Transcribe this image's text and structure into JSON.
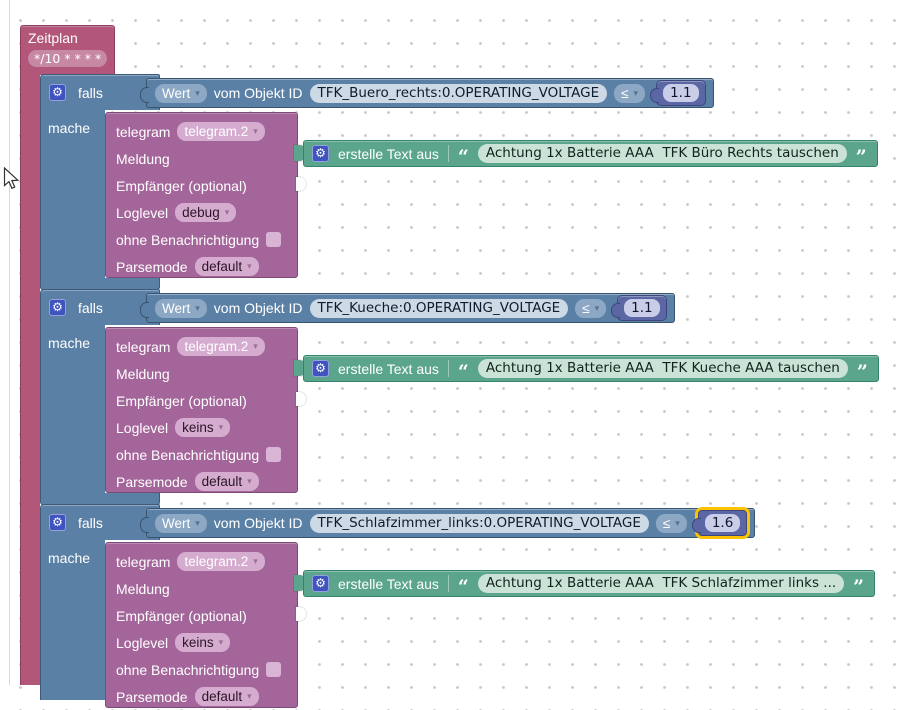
{
  "icons": {
    "gear": "⚙",
    "dropdown_arrow": "▾",
    "open_quote": "“",
    "close_quote": "”"
  },
  "colors": {
    "trigger_block": "#b2567a",
    "if_block": "#5b80a5",
    "number_block": "#5b67a5",
    "action_block": "#a4669a",
    "text_block": "#5ba58c",
    "selection_outline": "#fdc300"
  },
  "schedule": {
    "title": "Zeitplan",
    "cron": "*/10 * * * *"
  },
  "falls_blocks": [
    {
      "if_label": "falls",
      "do_label": "mache",
      "condition": {
        "field": "Wert",
        "of_label": "vom Objekt ID",
        "object_id": "TFK_Buero_rechts:0.OPERATING_VOLTAGE",
        "operator": "≤",
        "value": "1.1",
        "selected": false
      },
      "telegram": {
        "instance_label": "telegram",
        "instance_value": "telegram.2",
        "message_label": "Meldung",
        "recipient_label": "Empfänger (optional)",
        "loglevel_label": "Loglevel",
        "loglevel_value": "debug",
        "no_notification_label": "ohne Benachrichtigung",
        "parsemode_label": "Parsemode",
        "parsemode_value": "default"
      },
      "text_block": {
        "label": "erstelle Text aus",
        "text": "Achtung 1x Batterie AAA  TFK Büro Rechts tauschen"
      }
    },
    {
      "if_label": "falls",
      "do_label": "mache",
      "condition": {
        "field": "Wert",
        "of_label": "vom Objekt ID",
        "object_id": "TFK_Kueche:0.OPERATING_VOLTAGE",
        "operator": "≤",
        "value": "1.1",
        "selected": false
      },
      "telegram": {
        "instance_label": "telegram",
        "instance_value": "telegram.2",
        "message_label": "Meldung",
        "recipient_label": "Empfänger (optional)",
        "loglevel_label": "Loglevel",
        "loglevel_value": "keins",
        "no_notification_label": "ohne Benachrichtigung",
        "parsemode_label": "Parsemode",
        "parsemode_value": "default"
      },
      "text_block": {
        "label": "erstelle Text aus",
        "text": "Achtung 1x Batterie AAA  TFK Kueche AAA tauschen"
      }
    },
    {
      "if_label": "falls",
      "do_label": "mache",
      "condition": {
        "field": "Wert",
        "of_label": "vom Objekt ID",
        "object_id": "TFK_Schlafzimmer_links:0.OPERATING_VOLTAGE",
        "operator": "≤",
        "value": "1.6",
        "selected": true
      },
      "telegram": {
        "instance_label": "telegram",
        "instance_value": "telegram.2",
        "message_label": "Meldung",
        "recipient_label": "Empfänger (optional)",
        "loglevel_label": "Loglevel",
        "loglevel_value": "keins",
        "no_notification_label": "ohne Benachrichtigung",
        "parsemode_label": "Parsemode",
        "parsemode_value": "default"
      },
      "text_block": {
        "label": "erstelle Text aus",
        "text": "Achtung 1x Batterie AAA  TFK Schlafzimmer links ..."
      }
    }
  ]
}
